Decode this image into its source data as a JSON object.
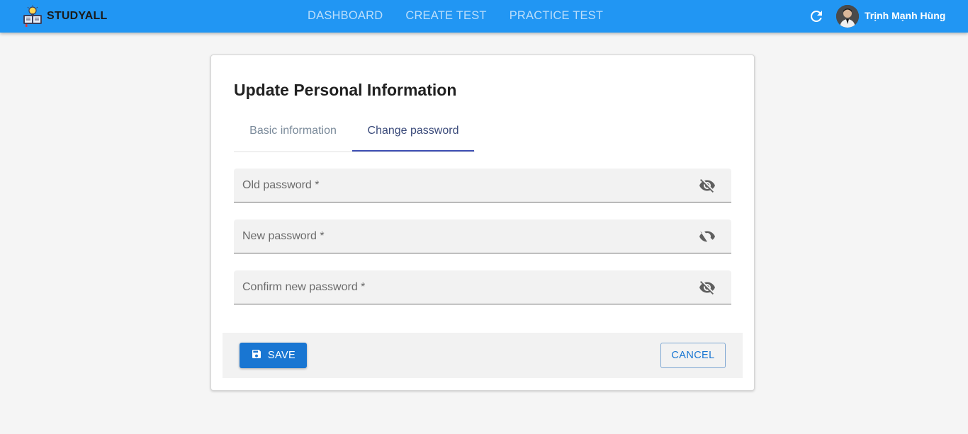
{
  "app": {
    "brand": "STUDYALL",
    "nav": [
      "DASHBOARD",
      "CREATE TEST",
      "PRACTICE TEST"
    ],
    "user_name": "Trịnh Mạnh Hùng",
    "accent_color": "#2196f3",
    "icons": {
      "logo": "study-logo-icon",
      "refresh": "refresh-icon",
      "avatar": "user-avatar"
    }
  },
  "form": {
    "title": "Update Personal Information",
    "tabs": [
      {
        "label": "Basic information",
        "active": false
      },
      {
        "label": "Change password",
        "active": true
      }
    ],
    "fields": [
      {
        "label": "Old password *",
        "value": "",
        "icon": "eye-off-icon"
      },
      {
        "label": "New password *",
        "value": "",
        "icon": "eye-off-icon"
      },
      {
        "label": "Confirm new password *",
        "value": "",
        "icon": "eye-off-icon"
      }
    ],
    "save_label": "SAVE",
    "cancel_label": "CANCEL",
    "save_color": "#1976d2"
  }
}
